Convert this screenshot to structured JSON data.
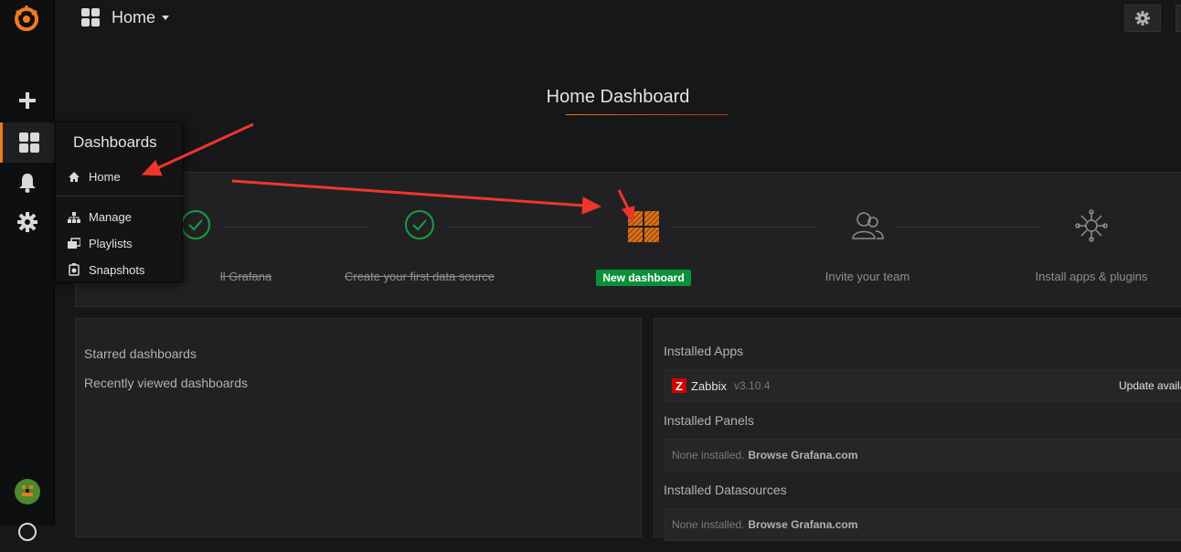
{
  "header": {
    "title": "Home"
  },
  "page": {
    "title": "Home Dashboard"
  },
  "dashboards_menu": {
    "title": "Dashboards",
    "items": [
      {
        "label": "Home",
        "icon": "home-icon"
      },
      {
        "label": "Manage",
        "icon": "sitemap-icon"
      },
      {
        "label": "Playlists",
        "icon": "playlist-icon"
      },
      {
        "label": "Snapshots",
        "icon": "snapshot-icon"
      }
    ]
  },
  "steps": [
    {
      "label": "Install Grafana",
      "visible_label": "ll Grafana",
      "state": "done"
    },
    {
      "label": "Create your first data source",
      "state": "done"
    },
    {
      "label": "New dashboard",
      "state": "active"
    },
    {
      "label": "Invite your team",
      "state": "todo"
    },
    {
      "label": "Install apps & plugins",
      "state": "todo"
    }
  ],
  "left_panel": {
    "starred": "Starred dashboards",
    "recent": "Recently viewed dashboards"
  },
  "right_panel": {
    "apps_heading": "Installed Apps",
    "app": {
      "name": "Zabbix",
      "version": "v3.10.4",
      "update": "Update availa"
    },
    "panels_heading": "Installed Panels",
    "panels_none": "None installed.",
    "panels_link": "Browse Grafana.com",
    "datasources_heading": "Installed Datasources",
    "datasources_none": "None installed.",
    "datasources_link": "Browse Grafana.com"
  },
  "colors": {
    "accent": "#eb7b18",
    "success": "#0c8f3a",
    "annotation": "#f0352c"
  }
}
